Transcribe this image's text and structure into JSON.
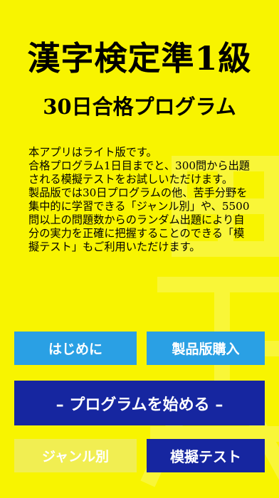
{
  "header": {
    "title": "漢字検定準1級",
    "subtitle": "30日合格プログラム"
  },
  "description": "本アプリはライト版です。\n合格プログラム1日目までと、300問から出題される模擬テストをお試しいただけます。\n製品版では30日プログラムの他、苦手分野を集中的に学習できる「ジャンル別」や、5500問以上の問題数からのランダム出題により自分の実力を正確に把握することのできる「模擬テスト」もご利用いただけます。",
  "buttons": {
    "intro": "はじめに",
    "purchase": "製品版購入",
    "start_program": "– プログラムを始める –",
    "genre": "ジャンル別",
    "mock_test": "模擬テスト"
  },
  "colors": {
    "background": "#f8f400",
    "button_blue": "#2aa0e4",
    "button_navy": "#1626a0",
    "button_disabled": "#f1ee52"
  }
}
